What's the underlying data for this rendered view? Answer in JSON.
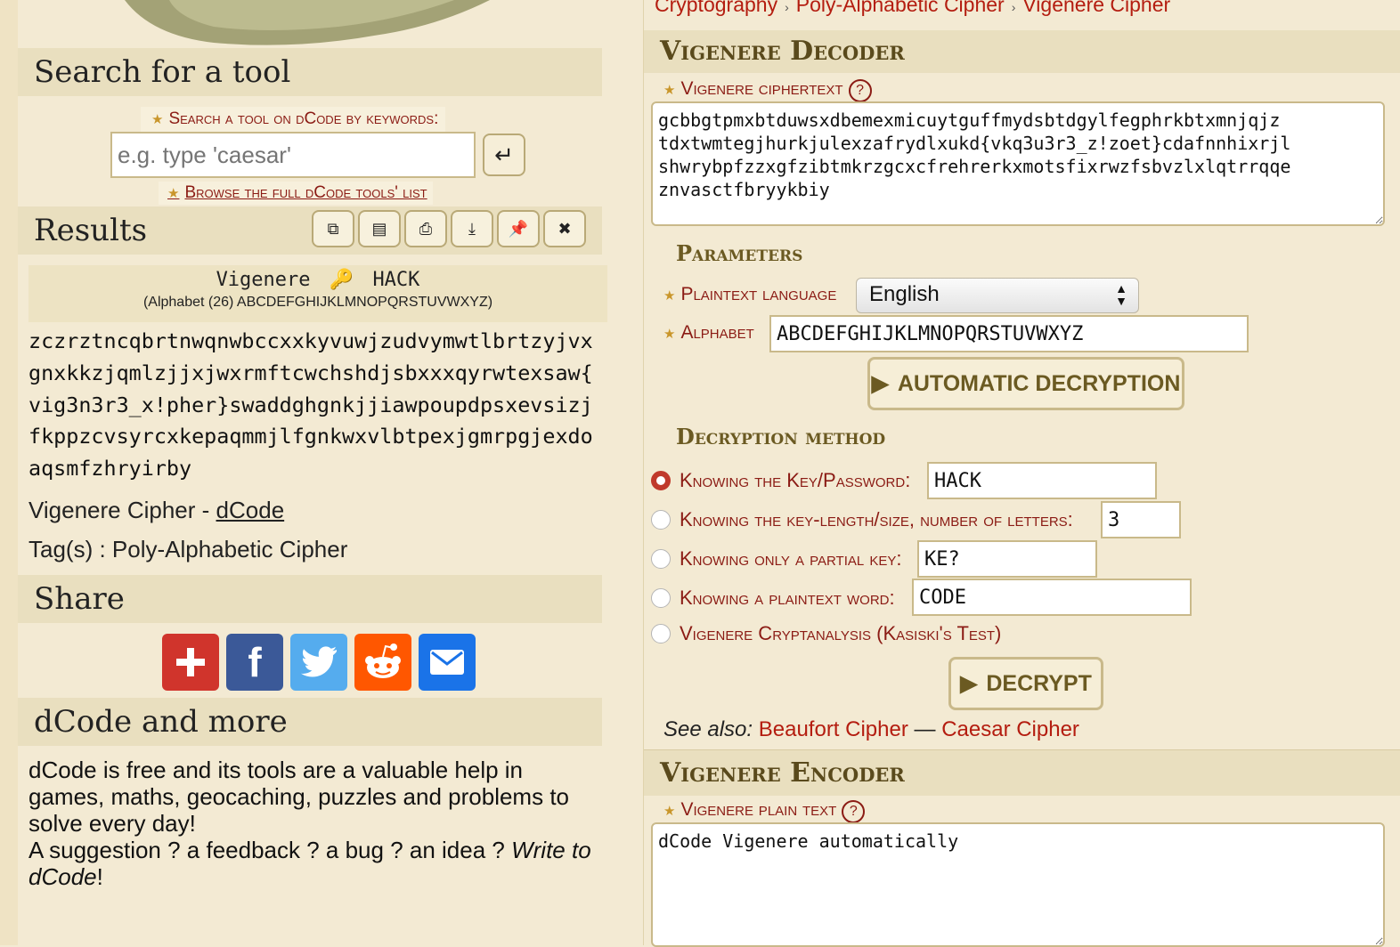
{
  "left": {
    "search": {
      "heading": "Search for a tool",
      "label": "Search a tool on dCode by keywords:",
      "placeholder": "e.g. type 'caesar'",
      "browse": "Browse the full dCode tools' list"
    },
    "results": {
      "heading": "Results",
      "toolbar": [
        "copy-icon",
        "save-icon",
        "print-icon",
        "download-icon",
        "pin-icon",
        "close-icon"
      ],
      "title_method": "Vigenere",
      "title_key": "HACK",
      "alphabet_line": "(Alphabet (26) ABCDEFGHIJKLMNOPQRSTUVWXYZ)",
      "text": "zczrztncqbrtnwqnwbccxxkyvuwjzudvymwtlbrtzyjvx\ngnxkkzjqmlzjjxjwxrmftcwchshdjsbxxxqyrwtexsaw{\nvig3n3r3_x!pher}swaddghgnkjjiawpoupdpsxevsizj\nfkppzcvsyrcxkepaqmmjlfgnkwxvlbtpexjgmrpgjexdo\naqsmfzhryirby",
      "source_prefix": "Vigenere Cipher - ",
      "source_link": "dCode",
      "tags": "Tag(s) : Poly-Alphabetic Cipher"
    },
    "share": {
      "heading": "Share",
      "buttons": [
        "plus-icon",
        "facebook-icon",
        "twitter-icon",
        "reddit-icon",
        "mail-icon"
      ]
    },
    "more": {
      "heading": "dCode and more",
      "text1": "dCode is free and its tools are a valuable help in games, maths, geocaching, puzzles and problems to solve every day!",
      "text2": "A suggestion ? a feedback ? a bug ? an idea ? ",
      "link": "Write to dCode",
      "text3": "!"
    }
  },
  "right": {
    "breadcrumb": [
      "Cryptography",
      "Poly-Alphabetic Cipher",
      "Vigenere Cipher"
    ],
    "decoder": {
      "heading": "Vigenere Decoder",
      "ciphertext_label": "Vigenere ciphertext",
      "ciphertext": "gcbbgtpmxbtduwsxdbemexmicuytguffmydsbtdgylfegphrkbtxmnjqjz\ntdxtwmtegjhurkjulexzafrydlxukd{vkq3u3r3_z!zoet}cdafnnhixrjl\nshwrybpfzzxgfzibtmkrzgcxcfrehrerkxmotsfixrwzfsbvzlxlqtrrqqe\nznvasctfbryykbiy",
      "parameters_heading": "Parameters",
      "language_label": "Plaintext language",
      "language_value": "English",
      "alphabet_label": "Alphabet",
      "alphabet_value": "ABCDEFGHIJKLMNOPQRSTUVWXYZ",
      "auto_button": "AUTOMATIC DECRYPTION",
      "method_heading": "Decryption method",
      "methods": [
        {
          "label": "Knowing the Key/Password:",
          "value": "HACK",
          "selected": true
        },
        {
          "label": "Knowing the key-length/size, number of letters:",
          "value": "3",
          "selected": false
        },
        {
          "label": "Knowing only a partial key:",
          "value": "KE?",
          "selected": false
        },
        {
          "label": "Knowing a plaintext word:",
          "value": "CODE",
          "selected": false
        },
        {
          "label": "Vigenere Cryptanalysis (Kasiski's Test)",
          "value": "",
          "selected": false
        }
      ],
      "decrypt_button": "DECRYPT",
      "see_also_label": "See also:",
      "see_also": [
        "Beaufort Cipher",
        "Caesar Cipher"
      ],
      "see_also_sep": " — "
    },
    "encoder": {
      "heading": "Vigenere Encoder",
      "plaintext_label": "Vigenere plain text",
      "plaintext": "dCode Vigenere automatically"
    }
  }
}
